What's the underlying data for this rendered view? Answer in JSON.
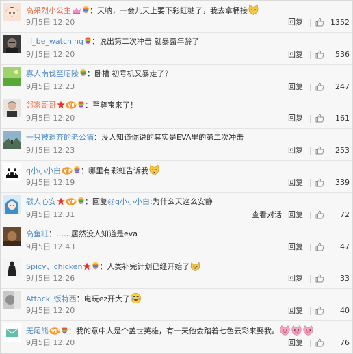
{
  "comments": [
    {
      "user": "高采烈小公主",
      "user_style": "orange",
      "badges": [
        "vip-crown",
        "rainbow"
      ],
      "text": "：天呐，一会儿天上要下彩虹糖了，我去拿桶接",
      "emoji": "cat",
      "emoji2": "",
      "time": "9月5日 12:20",
      "view_thread": "",
      "reply": "回复",
      "likes": "1352",
      "avatar": "avatar-cartoon-girl"
    },
    {
      "user": "lll_be_watching",
      "user_style": "link",
      "badges": [
        "rainbow"
      ],
      "text": "：说出第二次冲击 就暴露年龄了",
      "emoji": "",
      "emoji2": "",
      "time": "9月5日 12:20",
      "view_thread": "",
      "reply": "回复",
      "likes": "536",
      "avatar": "avatar-dark-face"
    },
    {
      "user": "寡人南伐至昭陵",
      "user_style": "link",
      "badges": [
        "rainbow"
      ],
      "text": "：卧槽 初号机又暴走了？",
      "emoji": "",
      "emoji2": "",
      "time": "9月5日 12:23",
      "view_thread": "",
      "reply": "回复",
      "likes": "247",
      "avatar": "avatar-green-field"
    },
    {
      "user": "邻家哥哥",
      "user_style": "orange",
      "badges": [
        "red-star",
        "member",
        "rainbow"
      ],
      "text": "：至尊宝来了！",
      "emoji": "",
      "emoji2": "",
      "time": "9月5日 12:20",
      "view_thread": "",
      "reply": "回复",
      "likes": "161",
      "avatar": "avatar-man-portrait"
    },
    {
      "user": "一只被遗弃的老公猫",
      "user_style": "link",
      "badges": [],
      "text": "：没人知道你说的其实是EVA里的第二次冲击",
      "emoji": "",
      "emoji2": "",
      "time": "9月5日 12:23",
      "view_thread": "",
      "reply": "回复",
      "likes": "253",
      "avatar": "avatar-landscape"
    },
    {
      "user": "q小小小白",
      "user_style": "link",
      "badges": [
        "member",
        "rainbow"
      ],
      "text": "：哪里有彩虹告诉我",
      "emoji": "cat",
      "emoji2": "",
      "time": "9月5日 12:19",
      "view_thread": "",
      "reply": "回复",
      "likes": "339",
      "avatar": "avatar-black-cat"
    },
    {
      "user": "慰人心安",
      "user_style": "link",
      "badges": [
        "red-star",
        "member",
        "rainbow"
      ],
      "text": "：回复",
      "mention": "@q小小小白",
      "text2": ":为什么天这么安静",
      "emoji": "",
      "emoji2": "",
      "time": "9月5日 12:31",
      "view_thread": "查看对话",
      "reply": "回复",
      "likes": "72",
      "avatar": "avatar-anime-blue"
    },
    {
      "user": "高鱼缸",
      "user_style": "link",
      "badges": [],
      "text": "：……居然没人知道是eva",
      "emoji": "",
      "emoji2": "",
      "time": "9月5日 12:43",
      "view_thread": "",
      "reply": "回复",
      "likes": "47",
      "avatar": "avatar-brown"
    },
    {
      "user": "Spicy、chicken",
      "user_style": "link",
      "badges": [
        "red-star",
        "rainbow"
      ],
      "text": "：人类补完计划已经开始了",
      "emoji": "dog",
      "emoji2": "",
      "time": "9月5日 12:26",
      "view_thread": "",
      "reply": "回复",
      "likes": "33",
      "avatar": "avatar-figure"
    },
    {
      "user": "Attack_饭特西",
      "user_style": "link",
      "badges": [],
      "text": "：电玩ez开大了",
      "emoji": "laugh",
      "emoji2": "",
      "time": "9月5日 12:20",
      "view_thread": "",
      "reply": "回复",
      "likes": "40",
      "avatar": "avatar-gray-face"
    },
    {
      "user": "无尾熊",
      "user_style": "link",
      "badges": [
        "member",
        "rainbow"
      ],
      "text": "：我的意中人是个盖世英雄，有一天他会踏着七色云彩来娶我。",
      "emoji": "pigs",
      "emoji2": "",
      "time": "9月5日 12:20",
      "view_thread": "",
      "reply": "回复",
      "likes": "76",
      "avatar": "avatar-envelope"
    }
  ],
  "colors": {
    "orange_name": "#eb7350",
    "link_name": "#4d8ac7",
    "text": "#333333",
    "meta": "#808080",
    "background": "#f7f7f7"
  }
}
